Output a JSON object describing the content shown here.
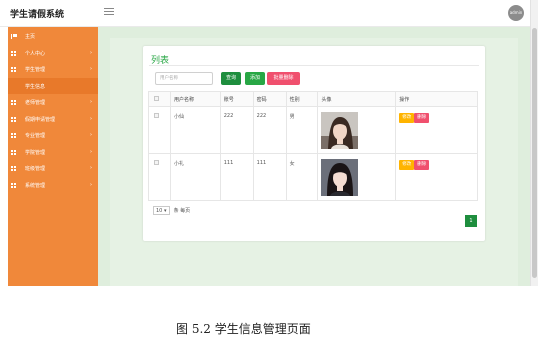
{
  "app": {
    "title": "学生请假系统",
    "avatar_text": "admin"
  },
  "sidebar": {
    "items": [
      {
        "label": "主页",
        "icon": "flag-icon",
        "has_arrow": false
      },
      {
        "label": "个人中心",
        "icon": "grid-icon",
        "has_arrow": true
      },
      {
        "label": "学生管理",
        "icon": "grid-icon",
        "has_arrow": true
      },
      {
        "label": "学生信息",
        "icon": "",
        "has_arrow": false,
        "sub": true
      },
      {
        "label": "老师管理",
        "icon": "grid-icon",
        "has_arrow": true
      },
      {
        "label": "假期申请管理",
        "icon": "grid-icon",
        "has_arrow": true
      },
      {
        "label": "专业管理",
        "icon": "grid-icon",
        "has_arrow": true
      },
      {
        "label": "学院管理",
        "icon": "grid-icon",
        "has_arrow": true
      },
      {
        "label": "班级管理",
        "icon": "grid-icon",
        "has_arrow": true
      },
      {
        "label": "系统管理",
        "icon": "grid-icon",
        "has_arrow": true
      }
    ],
    "arrow": "›"
  },
  "panel": {
    "title": "列表",
    "search_placeholder": "用户名称",
    "btn_search": "查询",
    "btn_add": "添加",
    "btn_bulk_delete": "批量删除"
  },
  "table": {
    "headers": [
      "",
      "用户名称",
      "账号",
      "密码",
      "性别",
      "头像",
      "操作"
    ],
    "rows": [
      {
        "name": "小仙",
        "account": "222",
        "password": "222",
        "gender": "男",
        "photo": "avatar-photo-female-1"
      },
      {
        "name": "小礼",
        "account": "111",
        "password": "111",
        "gender": "女",
        "photo": "avatar-photo-female-2"
      }
    ],
    "edit_label": "修改",
    "delete_label": "删除"
  },
  "pager": {
    "page_size": "10",
    "per_page_text": "条 每页",
    "current_page": "1"
  },
  "caption": "图 5.2  学生信息管理页面",
  "colors": {
    "sidebar": "#f0883a",
    "accent_green": "#1e8e3e",
    "danger": "#f0506e",
    "warning": "#ffb400"
  }
}
